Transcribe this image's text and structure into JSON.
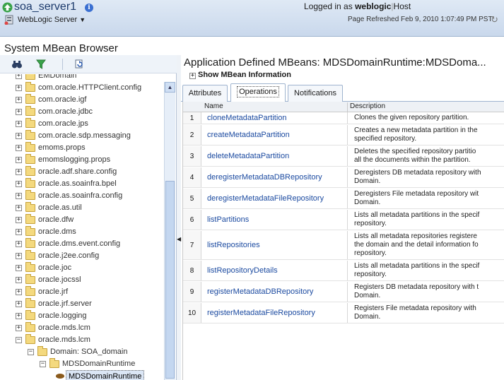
{
  "header": {
    "server_name": "soa_server1",
    "info_glyph": "i",
    "menu_label": "WebLogic Server",
    "menu_caret": "▼",
    "logged_in_prefix": "Logged in as",
    "username": "weblogic",
    "separator": "|",
    "host_label": "Host",
    "refresh_text": "Page Refreshed Feb 9, 2010 1:07:49 PM PST",
    "refresh_glyph": "↻",
    "colors": {
      "header_bg": "#dfe9f5",
      "server_name": "#1c3a6b"
    }
  },
  "page_title": "System MBean Browser",
  "toolbar": {
    "find_glyph": "⚲",
    "filter_glyph": "Y",
    "refresh_glyph": "⟳"
  },
  "tree": {
    "nodes": [
      {
        "label": "EMDomain",
        "expander": "+"
      },
      {
        "label": "com.oracle.HTTPClient.config",
        "expander": "+"
      },
      {
        "label": "com.oracle.igf",
        "expander": "+"
      },
      {
        "label": "com.oracle.jdbc",
        "expander": "+"
      },
      {
        "label": "com.oracle.jps",
        "expander": "+"
      },
      {
        "label": "com.oracle.sdp.messaging",
        "expander": "+"
      },
      {
        "label": "emoms.props",
        "expander": "+"
      },
      {
        "label": "emomslogging.props",
        "expander": "+"
      },
      {
        "label": "oracle.adf.share.config",
        "expander": "+"
      },
      {
        "label": "oracle.as.soainfra.bpel",
        "expander": "+"
      },
      {
        "label": "oracle.as.soainfra.config",
        "expander": "+"
      },
      {
        "label": "oracle.as.util",
        "expander": "+"
      },
      {
        "label": "oracle.dfw",
        "expander": "+"
      },
      {
        "label": "oracle.dms",
        "expander": "+"
      },
      {
        "label": "oracle.dms.event.config",
        "expander": "+"
      },
      {
        "label": "oracle.j2ee.config",
        "expander": "+"
      },
      {
        "label": "oracle.joc",
        "expander": "+"
      },
      {
        "label": "oracle.jocssl",
        "expander": "+"
      },
      {
        "label": "oracle.jrf",
        "expander": "+"
      },
      {
        "label": "oracle.jrf.server",
        "expander": "+"
      },
      {
        "label": "oracle.logging",
        "expander": "+"
      },
      {
        "label": "oracle.mds.lcm",
        "expander": "+"
      },
      {
        "label": "oracle.mds.lcm",
        "expander": "−"
      },
      {
        "label": "Domain: SOA_domain",
        "expander": "−"
      },
      {
        "label": "MDSDomainRuntime",
        "expander": "−"
      },
      {
        "label": "MDSDomainRuntime",
        "expander": ""
      }
    ],
    "scroll_up_glyph": "▲"
  },
  "splitter_glyph": "◀",
  "detail": {
    "title": "Application Defined MBeans: MDSDomainRuntime:MDSDoma...",
    "show_info_toggle": "+",
    "show_info_label": "Show MBean Information",
    "tabs": [
      {
        "label": "Attributes"
      },
      {
        "label": "Operations"
      },
      {
        "label": "Notifications"
      }
    ],
    "columns": {
      "name": "Name",
      "description": "Description"
    },
    "rows": [
      {
        "num": "1",
        "name": "cloneMetadataPartition",
        "desc": [
          "Clones the given repository partition."
        ]
      },
      {
        "num": "2",
        "name": "createMetadataPartition",
        "desc": [
          "Creates a new metadata partition in the",
          "specified repository."
        ]
      },
      {
        "num": "3",
        "name": "deleteMetadataPartition",
        "desc": [
          "Deletes the specified repository partitio",
          "all the documents within the partition."
        ]
      },
      {
        "num": "4",
        "name": "deregisterMetadataDBRepository",
        "desc": [
          "Deregisters DB metadata repository with",
          "Domain."
        ]
      },
      {
        "num": "5",
        "name": "deregisterMetadataFileRepository",
        "desc": [
          "Deregisters File metadata repository wit",
          "Domain."
        ]
      },
      {
        "num": "6",
        "name": "listPartitions",
        "desc": [
          "Lists all metadata partitions in the specif",
          "repository."
        ]
      },
      {
        "num": "7",
        "name": "listRepositories",
        "desc": [
          "Lists all metadata repositories registere",
          "the domain and the detail information fo",
          "repository."
        ]
      },
      {
        "num": "8",
        "name": "listRepositoryDetails",
        "desc": [
          "Lists all metadata partitions in the specif",
          "repository."
        ]
      },
      {
        "num": "9",
        "name": "registerMetadataDBRepository",
        "desc": [
          "Registers DB metadata repository with t",
          "Domain."
        ]
      },
      {
        "num": "10",
        "name": "registerMetadataFileRepository",
        "desc": [
          "Registers File metadata repository with",
          "Domain."
        ]
      }
    ]
  }
}
